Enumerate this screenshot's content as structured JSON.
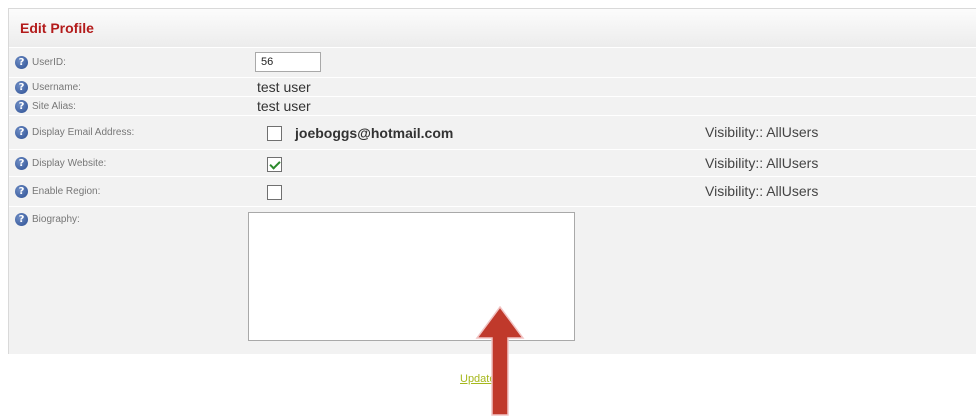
{
  "header": {
    "title": "Edit Profile"
  },
  "fields": {
    "userid": {
      "label": "UserID:",
      "value": "56"
    },
    "username": {
      "label": "Username:",
      "value": "test user"
    },
    "site_alias": {
      "label": "Site Alias:",
      "value": "test user"
    },
    "display_email": {
      "label": "Display Email Address:",
      "checked": false,
      "email": "joeboggs@hotmail.com",
      "visibility": "Visibility:: AllUsers"
    },
    "display_website": {
      "label": "Display Website:",
      "checked": true,
      "visibility": "Visibility:: AllUsers"
    },
    "enable_region": {
      "label": "Enable Region:",
      "checked": false,
      "visibility": "Visibility:: AllUsers"
    },
    "biography": {
      "label": "Biography:",
      "value": ""
    }
  },
  "actions": {
    "update_label": "Update"
  },
  "icons": {
    "help": "help-question-icon",
    "help_glyph": "?",
    "annotation": "red-up-arrow"
  },
  "colors": {
    "title": "#b31b1b",
    "link": "#a6b81c",
    "arrow": "#c0392b"
  }
}
